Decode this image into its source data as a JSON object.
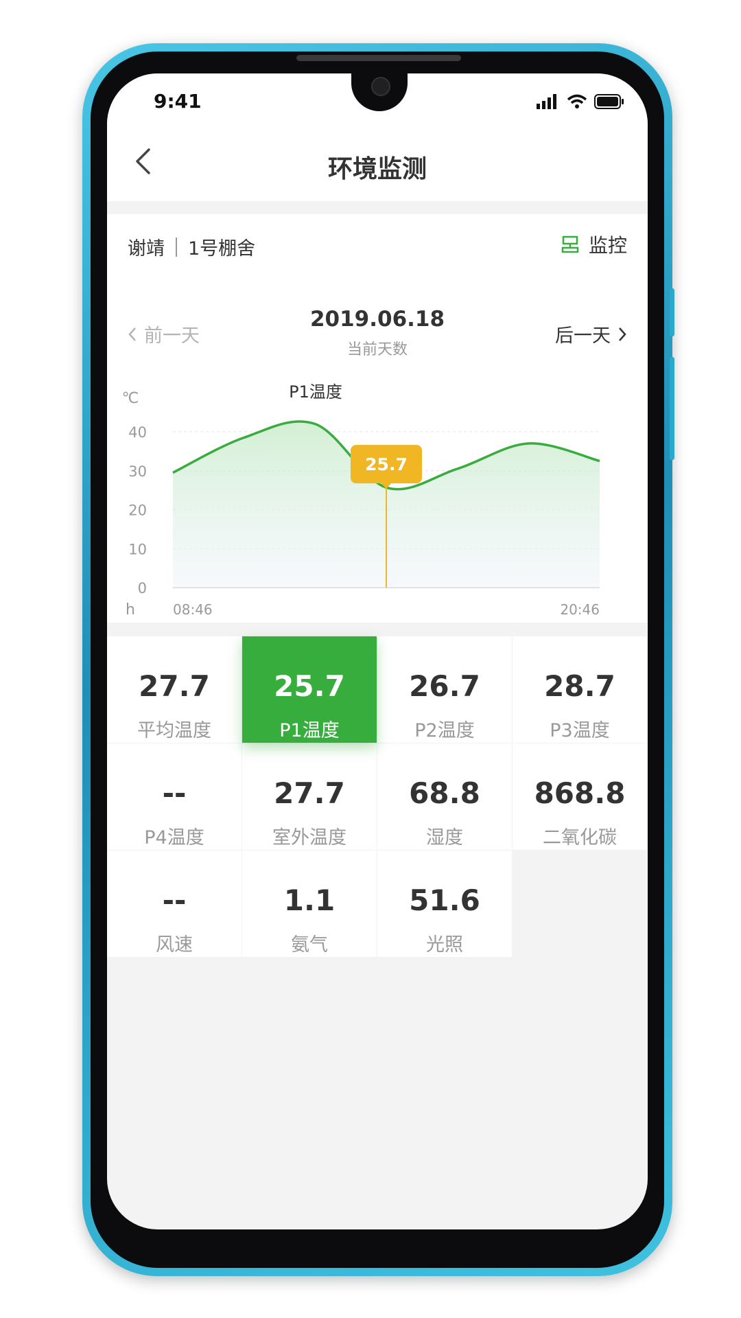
{
  "status_bar": {
    "time": "9:41"
  },
  "nav": {
    "title": "环境监测"
  },
  "location": {
    "user": "谢靖",
    "shed": "1号棚舍",
    "monitor_label": "监控"
  },
  "date_nav": {
    "prev_label": "前一天",
    "next_label": "后一天",
    "date": "2019.06.18",
    "sub": "当前天数"
  },
  "chart_data": {
    "type": "area",
    "title": "P1温度",
    "ylabel": "℃",
    "xlabel": "h",
    "ylim": [
      0,
      40
    ],
    "yticks": [
      0,
      10,
      20,
      30,
      40
    ],
    "x_labels": [
      "08:46",
      "20:46"
    ],
    "x": [
      "08:46",
      "10:46",
      "12:46",
      "14:46",
      "16:46",
      "18:46",
      "20:46"
    ],
    "series": [
      {
        "values": [
          29.5,
          38.5,
          42,
          25.7,
          30.5,
          37,
          32.5
        ]
      }
    ],
    "tooltip": {
      "label": "25.7",
      "x": "14:46"
    },
    "grid": true,
    "colors": {
      "line": "#3aab3f",
      "tooltip": "#f0b623"
    }
  },
  "metrics": [
    {
      "value": "27.7",
      "label": "平均温度"
    },
    {
      "value": "25.7",
      "label": "P1温度",
      "active": true
    },
    {
      "value": "26.7",
      "label": "P2温度"
    },
    {
      "value": "28.7",
      "label": "P3温度"
    },
    {
      "value": "--",
      "label": "P4温度"
    },
    {
      "value": "27.7",
      "label": "室外温度"
    },
    {
      "value": "68.8",
      "label": "湿度"
    },
    {
      "value": "868.8",
      "label": "二氧化碳"
    },
    {
      "value": "--",
      "label": "风速"
    },
    {
      "value": "1.1",
      "label": "氨气"
    },
    {
      "value": "51.6",
      "label": "光照"
    }
  ]
}
